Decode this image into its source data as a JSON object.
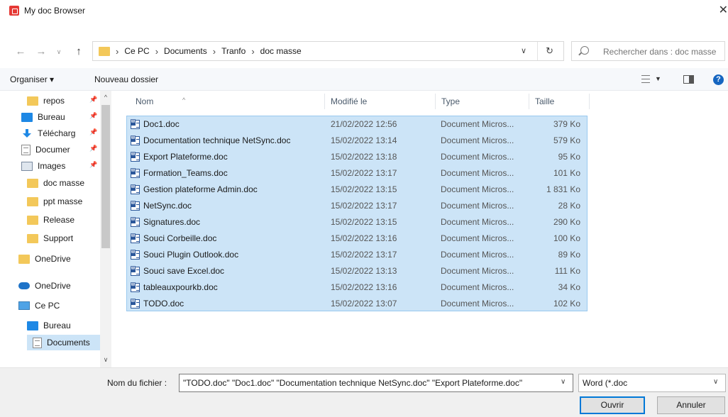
{
  "window": {
    "title": "My doc Browser",
    "close_glyph": "✕"
  },
  "address": {
    "crumbs": [
      "Ce PC",
      "Documents",
      "Tranfo",
      "doc masse"
    ],
    "separator": "›"
  },
  "search": {
    "placeholder": "Rechercher dans : doc masse"
  },
  "toolbar": {
    "organize_label": "Organiser ▾",
    "new_folder_label": "Nouveau dossier",
    "help_glyph": "?"
  },
  "nav": {
    "items": [
      {
        "label": "repos",
        "icon": "folder-icon",
        "pinned": true
      },
      {
        "label": "Bureau",
        "icon": "desktop-icon",
        "pinned": true
      },
      {
        "label": "Télécharg",
        "icon": "download-icon",
        "pinned": true
      },
      {
        "label": "Documer",
        "icon": "document-icon",
        "pinned": true
      },
      {
        "label": "Images",
        "icon": "images-icon",
        "pinned": true
      },
      {
        "label": "doc masse",
        "icon": "folder-icon",
        "pinned": false
      },
      {
        "label": "ppt masse",
        "icon": "folder-icon",
        "pinned": false
      },
      {
        "label": "Release",
        "icon": "folder-icon",
        "pinned": false
      },
      {
        "label": "Support",
        "icon": "folder-icon",
        "pinned": false
      },
      {
        "label": "OneDrive",
        "icon": "folder-icon",
        "pinned": false
      },
      {
        "label": "OneDrive",
        "icon": "cloud-icon",
        "pinned": false
      },
      {
        "label": "Ce PC",
        "icon": "computer-icon",
        "pinned": false
      },
      {
        "label": "Bureau",
        "icon": "desktop-icon",
        "pinned": false
      },
      {
        "label": "Documents",
        "icon": "document-icon",
        "pinned": false,
        "selected": true
      }
    ]
  },
  "table": {
    "columns": [
      "Nom",
      "Modifié le",
      "Type",
      "Taille"
    ],
    "rows": [
      {
        "name": "Doc1.doc",
        "date": "21/02/2022 12:56",
        "type": "Document Micros...",
        "size": "379 Ko"
      },
      {
        "name": "Documentation technique NetSync.doc",
        "date": "15/02/2022 13:14",
        "type": "Document Micros...",
        "size": "579 Ko"
      },
      {
        "name": "Export Plateforme.doc",
        "date": "15/02/2022 13:18",
        "type": "Document Micros...",
        "size": "95 Ko"
      },
      {
        "name": "Formation_Teams.doc",
        "date": "15/02/2022 13:17",
        "type": "Document Micros...",
        "size": "101 Ko"
      },
      {
        "name": "Gestion plateforme Admin.doc",
        "date": "15/02/2022 13:15",
        "type": "Document Micros...",
        "size": "1 831 Ko"
      },
      {
        "name": "NetSync.doc",
        "date": "15/02/2022 13:17",
        "type": "Document Micros...",
        "size": "28 Ko"
      },
      {
        "name": "Signatures.doc",
        "date": "15/02/2022 13:15",
        "type": "Document Micros...",
        "size": "290 Ko"
      },
      {
        "name": "Souci Corbeille.doc",
        "date": "15/02/2022 13:16",
        "type": "Document Micros...",
        "size": "100 Ko"
      },
      {
        "name": "Souci Plugin Outlook.doc",
        "date": "15/02/2022 13:17",
        "type": "Document Micros...",
        "size": "89 Ko"
      },
      {
        "name": "Souci save Excel.doc",
        "date": "15/02/2022 13:13",
        "type": "Document Micros...",
        "size": "111 Ko"
      },
      {
        "name": "tableauxpourkb.doc",
        "date": "15/02/2022 13:16",
        "type": "Document Micros...",
        "size": "34 Ko"
      },
      {
        "name": "TODO.doc",
        "date": "15/02/2022 13:07",
        "type": "Document Micros...",
        "size": "102 Ko"
      }
    ]
  },
  "footer": {
    "filename_label": "Nom du fichier :",
    "filename_value": "\"TODO.doc\" \"Doc1.doc\" \"Documentation technique NetSync.doc\" \"Export Plateforme.doc\"",
    "filetype_value": "Word (*.doc",
    "open_label": "Ouvrir",
    "cancel_label": "Annuler"
  },
  "colors": {
    "selection_bg": "#cce4f7",
    "selection_border": "#99c9ef",
    "accent": "#0078d7",
    "folder": "#f3c85a"
  }
}
